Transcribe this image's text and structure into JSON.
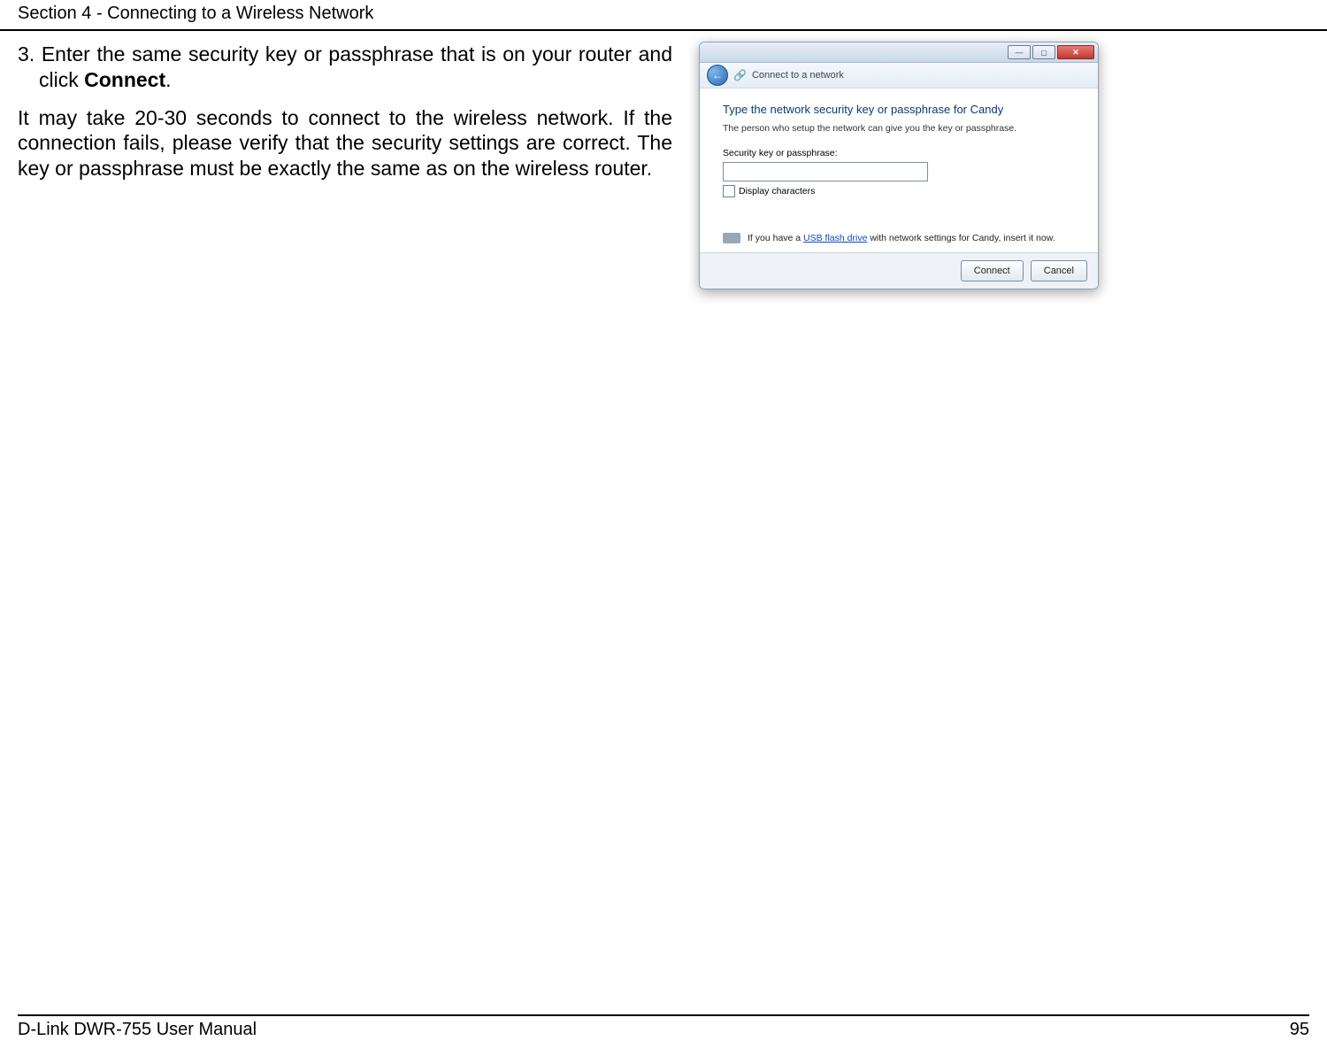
{
  "header": {
    "section_title": "Section 4 - Connecting to a Wireless Network"
  },
  "body": {
    "step3_line1": "3. Enter the same security key or passphrase that is on your router and",
    "step3_line2_prefix": "click ",
    "step3_bold": "Connect",
    "step3_line2_suffix": ".",
    "para2": "It may take 20-30 seconds to connect to the wireless network. If the connection fails, please verify that the security settings are correct. The key or passphrase must be exactly the same as on the wireless router."
  },
  "dialog": {
    "ribbon_text": "Connect to a network",
    "title": "Type the network security key or passphrase for Candy",
    "subtitle": "The person who setup the network can give you the key or passphrase.",
    "field_label": "Security key or passphrase:",
    "display_chars": "Display characters",
    "usb_pre": "If you have a ",
    "usb_link": "USB flash drive",
    "usb_post": " with network settings for Candy, insert it now.",
    "connect": "Connect",
    "cancel": "Cancel"
  },
  "footer": {
    "left": "D-Link DWR-755 User Manual",
    "right": "95"
  }
}
